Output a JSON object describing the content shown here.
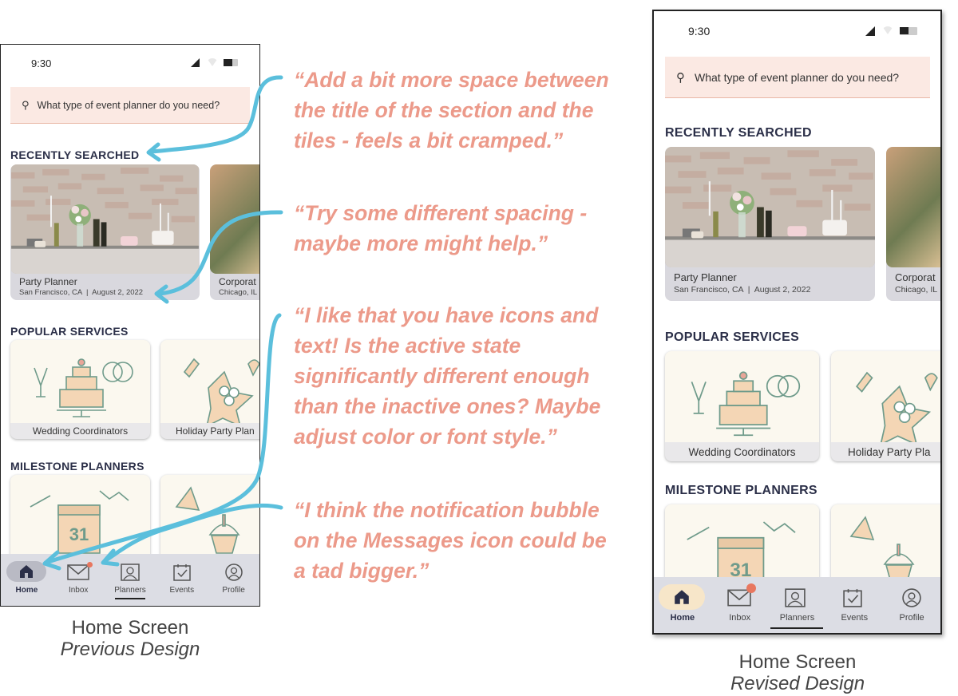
{
  "old": {
    "status_time": "9:30",
    "search_placeholder": "What type of event planner do you need?",
    "sections": {
      "recent": "RECENTLY SEARCHED",
      "popular": "POPULAR SERVICES",
      "milestone": "MILESTONE PLANNERS"
    },
    "recent_cards": [
      {
        "title": "Party Planner",
        "subtitle": "San Francisco, CA  |  August 2, 2022"
      },
      {
        "title": "Corporat",
        "subtitle": "Chicago, IL"
      }
    ],
    "services": [
      "Wedding Coordinators",
      "Holiday Party Plan"
    ],
    "nav": {
      "home": "Home",
      "inbox": "Inbox",
      "planners": "Planners",
      "events": "Events",
      "profile": "Profile"
    }
  },
  "new": {
    "status_time": "9:30",
    "search_placeholder": "What type of event planner do you need?",
    "sections": {
      "recent": "RECENTLY SEARCHED",
      "popular": "POPULAR SERVICES",
      "milestone": "MILESTONE PLANNERS"
    },
    "recent_cards": [
      {
        "title": "Party Planner",
        "subtitle": "San Francisco, CA  |  August 2, 2022"
      },
      {
        "title": "Corporat",
        "subtitle": "Chicago, IL"
      }
    ],
    "services": [
      "Wedding Coordinators",
      "Holiday Party Pla"
    ],
    "nav": {
      "home": "Home",
      "inbox": "Inbox",
      "planners": "Planners",
      "events": "Events",
      "profile": "Profile"
    }
  },
  "calendar_day": "31",
  "annotations": [
    "“Add a bit more space between\nthe title of the section and the\ntiles - feels a bit cramped.”",
    "“Try some different spacing -\nmaybe more might help.”",
    "“I like that you have icons and\ntext! Is the active state\nsignificantly different enough\nthan the inactive ones? Maybe\nadjust color or font style.”",
    "“I think the notification bubble\non the Messages icon could be\na tad bigger.”"
  ],
  "captions": {
    "old_title": "Home Screen",
    "old_sub": "Previous Design",
    "new_title": "Home Screen",
    "new_sub": "Revised Design"
  },
  "colors": {
    "annotation_text": "#ec9a8a",
    "arrow": "#5bbfdc",
    "search_bg": "#fbe9e3",
    "nav_bg": "#dcdde4",
    "active_pill_old": "#b9bac4",
    "active_pill_new": "#f7e6c9",
    "notification": "#e8775f",
    "section_title": "#2b2f48"
  }
}
